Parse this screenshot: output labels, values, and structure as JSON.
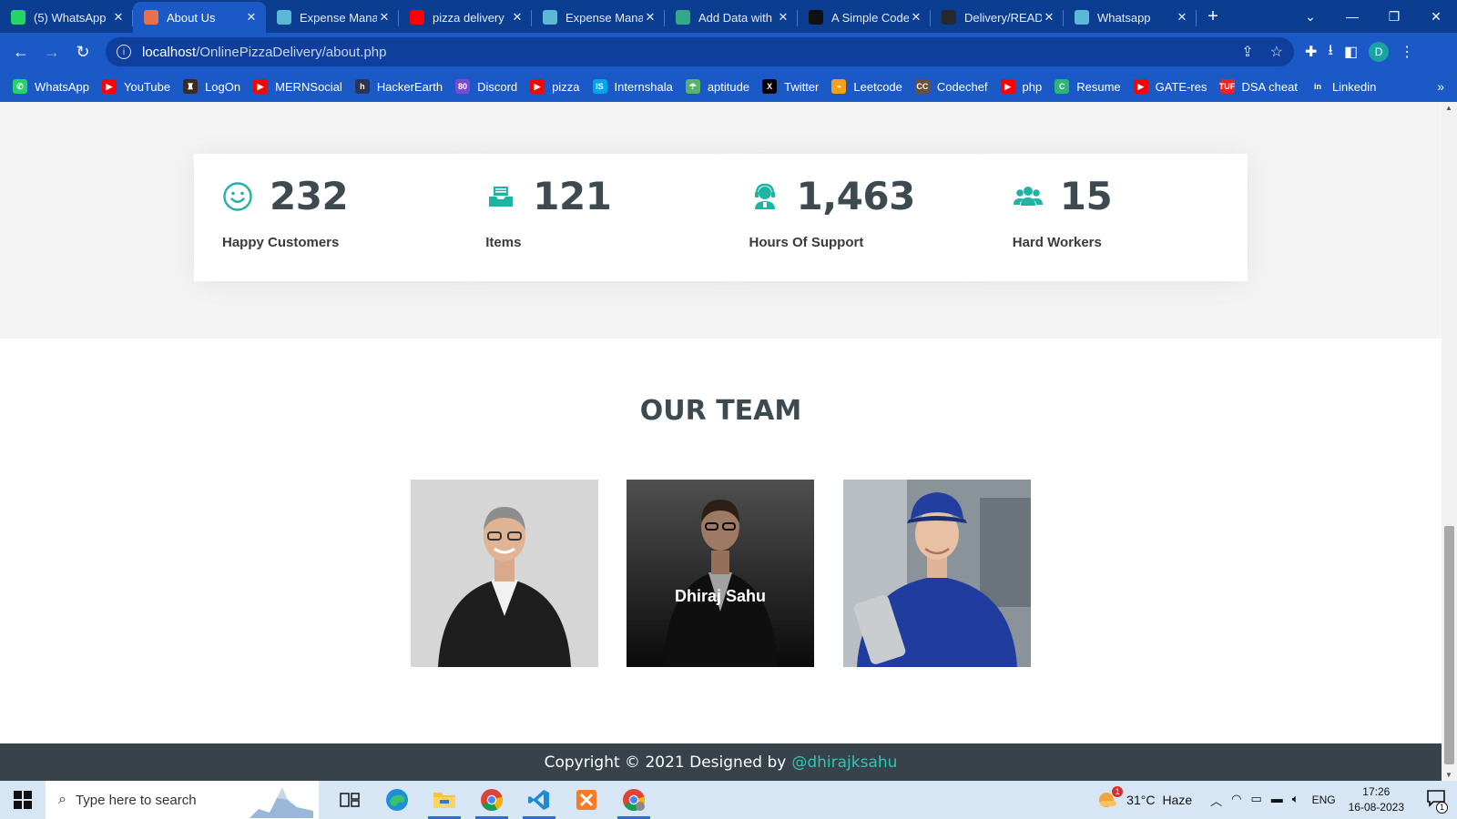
{
  "browser": {
    "tabs": [
      {
        "title": "(5) WhatsApp",
        "icon": "whatsapp-icon",
        "color": "#25d366"
      },
      {
        "title": "About Us",
        "icon": "pizza-icon",
        "color": "#e8704a",
        "active": true
      },
      {
        "title": "Expense Mana",
        "icon": "react-icon",
        "color": "#5bb9d6"
      },
      {
        "title": "pizza delivery",
        "icon": "youtube-icon",
        "color": "#ff0000"
      },
      {
        "title": "Expense Mana",
        "icon": "react-icon",
        "color": "#5bb9d6"
      },
      {
        "title": "Add Data with",
        "icon": "doc-icon",
        "color": "#34a88a"
      },
      {
        "title": "A Simple Code",
        "icon": "openai-icon",
        "color": "#111111"
      },
      {
        "title": "Delivery/READ",
        "icon": "github-icon",
        "color": "#24292e"
      },
      {
        "title": "Whatsapp",
        "icon": "react-icon",
        "color": "#5bb9d6"
      }
    ],
    "close_glyph": "✕",
    "new_tab_glyph": "+",
    "url_host": "localhost",
    "url_path": "/OnlinePizzaDelivery/about.php",
    "profile_initial": "D",
    "bookmarks": [
      {
        "label": "WhatsApp",
        "color": "#25d366",
        "glyph": "✆"
      },
      {
        "label": "YouTube",
        "color": "#ff0000",
        "glyph": "▶"
      },
      {
        "label": "LogOn",
        "color": "#3b2c20",
        "glyph": "♜"
      },
      {
        "label": "MERNSocial",
        "color": "#ff0000",
        "glyph": "▶"
      },
      {
        "label": "HackerEarth",
        "color": "#2c3454",
        "glyph": "h"
      },
      {
        "label": "Discord",
        "color": "#7a4ad6",
        "glyph": "80"
      },
      {
        "label": "pizza",
        "color": "#ff0000",
        "glyph": "▶"
      },
      {
        "label": "Internshala",
        "color": "#00a5ec",
        "glyph": "IS"
      },
      {
        "label": "aptitude",
        "color": "#58b368",
        "glyph": "☂"
      },
      {
        "label": "Twitter",
        "color": "#000000",
        "glyph": "X"
      },
      {
        "label": "Leetcode",
        "color": "#f89f1b",
        "glyph": "⌁"
      },
      {
        "label": "Codechef",
        "color": "#6b4f3a",
        "glyph": "CC"
      },
      {
        "label": "php",
        "color": "#ff0000",
        "glyph": "▶"
      },
      {
        "label": "Resume",
        "color": "#2bb673",
        "glyph": "C"
      },
      {
        "label": "GATE-res",
        "color": "#ff0000",
        "glyph": "▶"
      },
      {
        "label": "DSA cheat",
        "color": "#e52424",
        "glyph": "TUF"
      },
      {
        "label": "Linkedin",
        "color": "#1a59c6",
        "glyph": "in"
      }
    ],
    "bookmarks_more": "»"
  },
  "page": {
    "stats": [
      {
        "value": "232",
        "label": "Happy Customers",
        "icon": "smiley-icon"
      },
      {
        "value": "121",
        "label": "Items",
        "icon": "inbox-tray-icon"
      },
      {
        "value": "1,463",
        "label": "Hours Of Support",
        "icon": "headset-support-icon"
      },
      {
        "value": "15",
        "label": "Hard Workers",
        "icon": "users-group-icon"
      }
    ],
    "accent_color": "#1fb3a4",
    "team_title": "OUR TEAM",
    "team": [
      {
        "name": "",
        "bg": "#d9d9d9"
      },
      {
        "name": "Dhiraj Sahu",
        "bg": "#2a2a2a"
      },
      {
        "name": "",
        "bg": "#5b6773"
      }
    ],
    "footer_text": "Copyright © 2021 Designed by",
    "footer_handle": "@dhirajksahu"
  },
  "taskbar": {
    "search_placeholder": "Type here to search",
    "temperature": "31°C",
    "weather": "Haze",
    "language": "ENG",
    "time": "17:26",
    "date": "16-08-2023",
    "weather_badge": "1",
    "notification_badge": "1"
  }
}
